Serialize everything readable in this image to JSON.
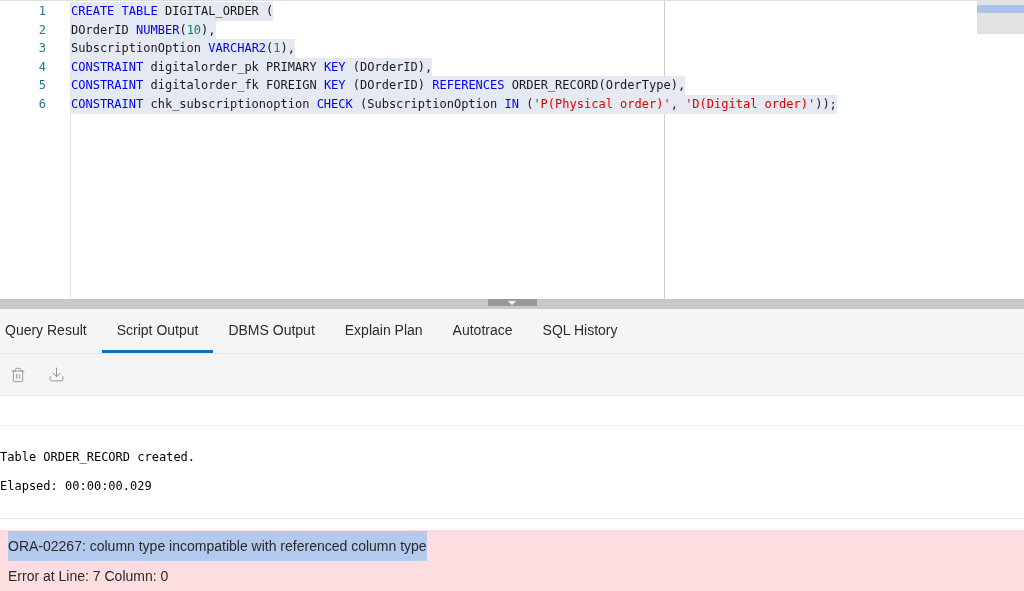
{
  "editor": {
    "lines": [
      {
        "number": "1",
        "selected": true,
        "tokens": [
          {
            "kind": "keyword",
            "text": "CREATE TABLE"
          },
          {
            "kind": "plain",
            "text": " DIGITAL_ORDER ("
          }
        ]
      },
      {
        "number": "2",
        "selected": true,
        "tokens": [
          {
            "kind": "plain",
            "text": "DOrderID "
          },
          {
            "kind": "keyword",
            "text": "NUMBER"
          },
          {
            "kind": "plain",
            "text": "("
          },
          {
            "kind": "number",
            "text": "10"
          },
          {
            "kind": "plain",
            "text": "),"
          }
        ]
      },
      {
        "number": "3",
        "selected": true,
        "tokens": [
          {
            "kind": "plain",
            "text": "SubscriptionOption "
          },
          {
            "kind": "keyword",
            "text": "VARCHAR2"
          },
          {
            "kind": "plain",
            "text": "("
          },
          {
            "kind": "number",
            "text": "1"
          },
          {
            "kind": "plain",
            "text": "),"
          }
        ]
      },
      {
        "number": "4",
        "selected": true,
        "tokens": [
          {
            "kind": "keyword",
            "text": "CONSTRAINT"
          },
          {
            "kind": "plain",
            "text": " digitalorder_pk PRIMARY "
          },
          {
            "kind": "keyword",
            "text": "KEY"
          },
          {
            "kind": "plain",
            "text": " (DOrderID),"
          }
        ]
      },
      {
        "number": "5",
        "selected": true,
        "tokens": [
          {
            "kind": "keyword",
            "text": "CONSTRAINT"
          },
          {
            "kind": "plain",
            "text": " digitalorder_fk FOREIGN "
          },
          {
            "kind": "keyword",
            "text": "KEY"
          },
          {
            "kind": "plain",
            "text": " (DOrderID) "
          },
          {
            "kind": "keyword",
            "text": "REFERENCES"
          },
          {
            "kind": "plain",
            "text": " ORDER_RECORD(OrderType),"
          }
        ]
      },
      {
        "number": "6",
        "selected": true,
        "tokens": [
          {
            "kind": "keyword",
            "text": "CONSTRAINT"
          },
          {
            "kind": "plain",
            "text": " chk_subscriptionoption "
          },
          {
            "kind": "keyword",
            "text": "CHECK"
          },
          {
            "kind": "plain",
            "text": " (SubscriptionOption "
          },
          {
            "kind": "keyword",
            "text": "IN"
          },
          {
            "kind": "plain",
            "text": " ("
          },
          {
            "kind": "string",
            "text": "'P(Physical order)'"
          },
          {
            "kind": "plain",
            "text": ", "
          },
          {
            "kind": "string",
            "text": "'D(Digital order)'"
          },
          {
            "kind": "plain",
            "text": "));"
          }
        ]
      }
    ]
  },
  "tabs": [
    {
      "label": "Query Result",
      "selected": false
    },
    {
      "label": "Script Output",
      "selected": true
    },
    {
      "label": "DBMS Output",
      "selected": false
    },
    {
      "label": "Explain Plan",
      "selected": false
    },
    {
      "label": "Autotrace",
      "selected": false
    },
    {
      "label": "SQL History",
      "selected": false
    }
  ],
  "output": {
    "lines": [
      "Table ORDER_RECORD created.",
      "Elapsed: 00:00:00.029"
    ],
    "error": {
      "message": "ORA-02267: column type incompatible with referenced column type",
      "message_selected": true,
      "location": "Error at Line: 7 Column: 0"
    }
  }
}
